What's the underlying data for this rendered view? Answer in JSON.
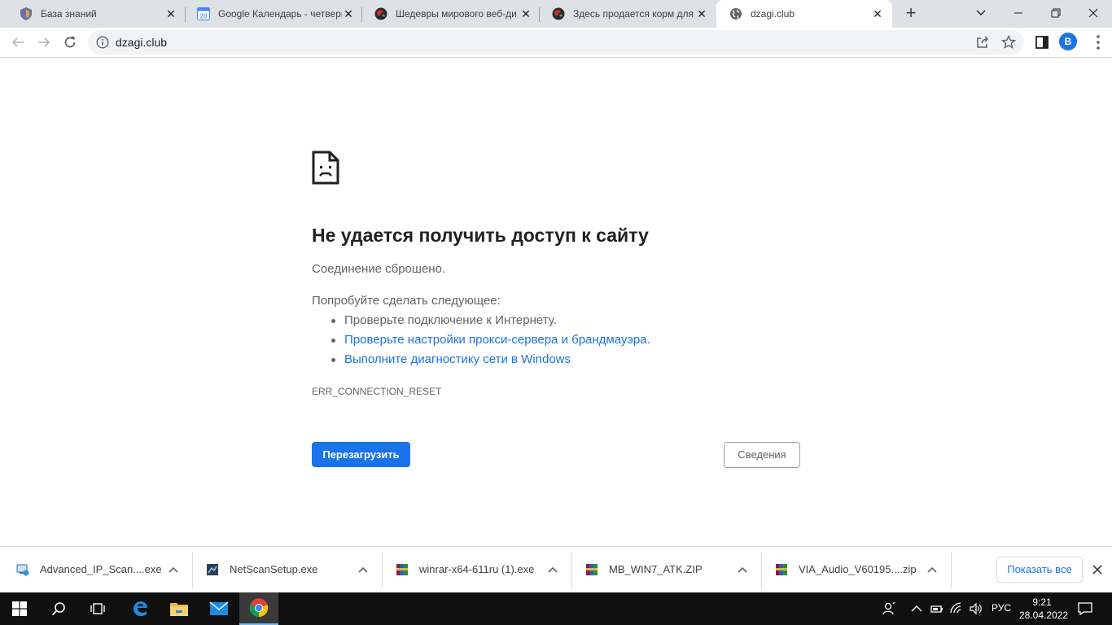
{
  "tabs": [
    {
      "title": "База знаний",
      "icon": "shield-favicon"
    },
    {
      "title": "Google Календарь - четверг",
      "icon": "calendar-favicon"
    },
    {
      "title": "Шедевры мирового веб-ди",
      "icon": "globe-colored-favicon"
    },
    {
      "title": "Здесь продается корм для г",
      "icon": "globe-colored-favicon"
    },
    {
      "title": "dzagi.club",
      "icon": "globe-favicon",
      "active": true
    }
  ],
  "calendar_icon_text": "28",
  "address_bar": {
    "url": "dzagi.club"
  },
  "profile_initial": "B",
  "error": {
    "title": "Не удается получить доступ к сайту",
    "subtitle": "Соединение сброшено.",
    "try_heading": "Попробуйте сделать следующее:",
    "suggestions": [
      "Проверьте подключение к Интернету.",
      "Проверьте настройки прокси-сервера и брандмауэра",
      "Выполните диагностику сети в Windows"
    ],
    "suggestion_2_suffix": ".",
    "code": "ERR_CONNECTION_RESET",
    "reload_button": "Перезагрузить",
    "details_button": "Сведения"
  },
  "downloads": [
    {
      "name": "Advanced_IP_Scan....exe",
      "icon": "installer-icon"
    },
    {
      "name": "NetScanSetup.exe",
      "icon": "netscan-icon"
    },
    {
      "name": "winrar-x64-611ru (1).exe",
      "icon": "winrar-icon"
    },
    {
      "name": "MB_WIN7_ATK.ZIP",
      "icon": "winrar-icon"
    },
    {
      "name": "VIA_Audio_V60195....zip",
      "icon": "winrar-icon"
    }
  ],
  "show_all_label": "Показать все",
  "taskbar": {
    "language": "РУС",
    "time": "9:21",
    "date": "28.04.2022"
  },
  "colors": {
    "accent": "#1a73e8",
    "tab_strip": "#dee1e6",
    "taskbar": "#101010"
  }
}
